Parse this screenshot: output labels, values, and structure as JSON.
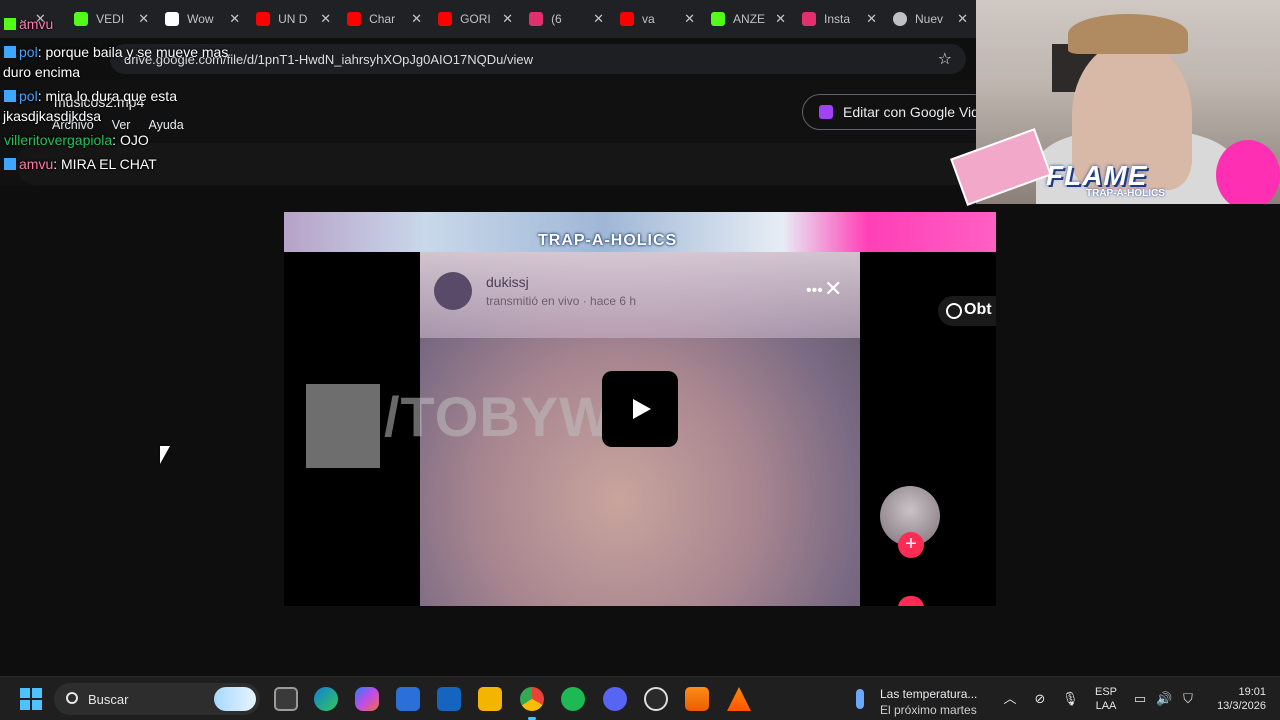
{
  "browser": {
    "tabs": [
      {
        "label": "VEDI",
        "icon": "kick-icon",
        "color": "#53fc18"
      },
      {
        "label": "Wow",
        "icon": "tiktok-icon",
        "color": "#ffffff"
      },
      {
        "label": "UN D",
        "icon": "youtube-icon",
        "color": "#ff0000"
      },
      {
        "label": "Char",
        "icon": "youtube-icon",
        "color": "#ff0000"
      },
      {
        "label": "GORI",
        "icon": "youtube-icon",
        "color": "#ff0000"
      },
      {
        "label": "(6",
        "icon": "instagram-icon",
        "color": "#e1306c"
      },
      {
        "label": "va",
        "icon": "youtube-icon",
        "color": "#ff0000"
      },
      {
        "label": "ANZE",
        "icon": "kick-icon",
        "color": "#53fc18"
      },
      {
        "label": "Insta",
        "icon": "instagram-icon",
        "color": "#e1306c"
      },
      {
        "label": "Nuev",
        "icon": "chrome-icon",
        "color": "#c0c0c0"
      }
    ],
    "url": "drive.google.com/file/d/1pnT1-HwdN_iahrsyhXOpJg0AIO17NQDu/view"
  },
  "drive": {
    "filename": "musicos2.mp4",
    "menus": [
      "Archivo",
      "Ver",
      "Ayuda"
    ],
    "edit_button": "Editar con Google Vid"
  },
  "chat": {
    "messages": [
      {
        "user": "amvu",
        "text": ""
      },
      {
        "user": "pol",
        "text": ": porque baila y se mueve mas"
      },
      {
        "user": "",
        "text": "duro encima"
      },
      {
        "user": "pol",
        "text": ": mira lo dura que esta"
      },
      {
        "user": "",
        "text": "jkasdjkasdjkdsa"
      },
      {
        "user": "villeritovergapiola",
        "text": ": OJO"
      },
      {
        "user": "amvu",
        "text": ": MIRA EL CHAT"
      }
    ]
  },
  "video": {
    "banner_text": "TRAP-A-HOLICS",
    "watermark": "/TOBYWI",
    "live_user": "dukissj",
    "live_status": "transmitió en vivo · hace 6 h",
    "obtain_label": "Obt"
  },
  "webcam": {
    "overlay_title": "FLAME",
    "overlay_subtitle": "TRAP-A-HOLICS"
  },
  "taskbar": {
    "search_placeholder": "Buscar",
    "weather_line1": "Las temperatura...",
    "weather_line2": "El próximo martes",
    "lang_line1": "ESP",
    "lang_line2": "LAA",
    "time": "19:01",
    "date": "13/3/2026"
  }
}
